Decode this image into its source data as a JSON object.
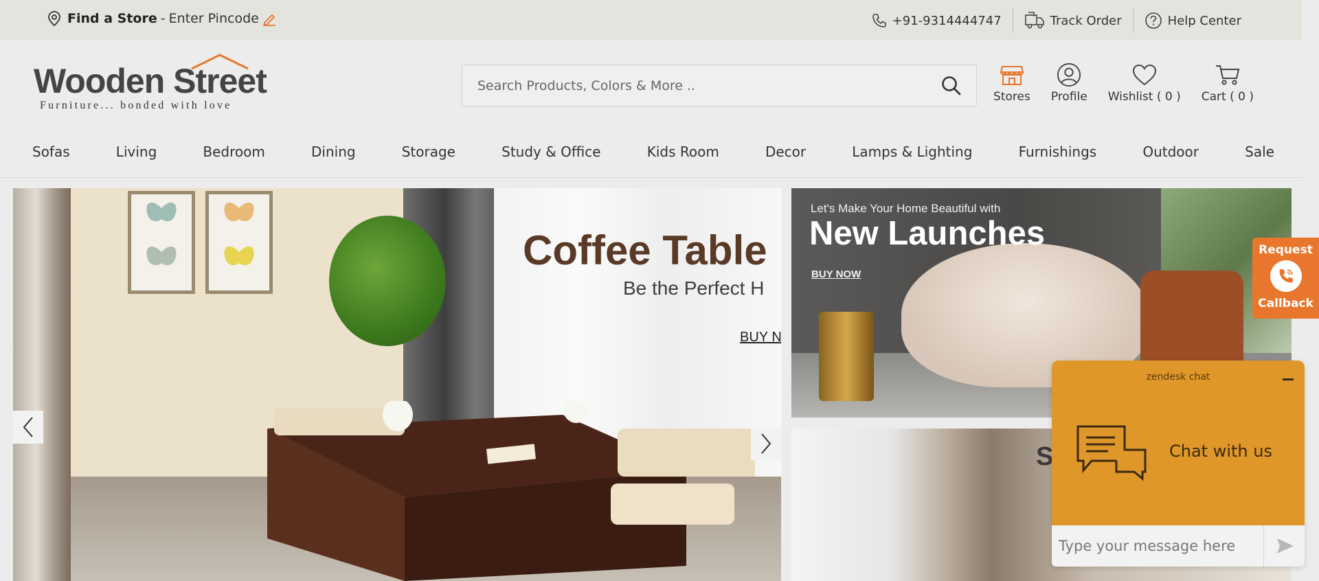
{
  "topbar": {
    "find_store": "Find a Store",
    "dash": "-",
    "pincode": "Enter Pincode",
    "phone": "+91-9314444747",
    "track_order": "Track Order",
    "help_center": "Help Center"
  },
  "header": {
    "logo_name": "Wooden Street",
    "logo_tagline": "Furniture... bonded with love",
    "search_placeholder": "Search Products, Colors & More ..",
    "stores": "Stores",
    "profile": "Profile",
    "wishlist": "Wishlist ( 0 )",
    "cart": "Cart ( 0 )"
  },
  "nav": {
    "items": [
      "Sofas",
      "Living",
      "Bedroom",
      "Dining",
      "Storage",
      "Study & Office",
      "Kids Room",
      "Decor",
      "Lamps & Lighting",
      "Furnishings",
      "Outdoor",
      "Sale"
    ]
  },
  "hero": {
    "title": "Coffee Table",
    "subtitle": "Be the Perfect H",
    "cta": "BUY N"
  },
  "side_banner_1": {
    "kicker": "Let's Make Your Home Beautiful with",
    "title": "New Launches",
    "cta": "BUY NOW"
  },
  "side_banner_2": {
    "title_fragment": "S"
  },
  "callback": {
    "line1": "Request",
    "line2": "Callback"
  },
  "chat": {
    "brand": "zendesk chat",
    "cta": "Chat with us",
    "input_placeholder": "Type your message here"
  },
  "colors": {
    "accent_orange": "#e8762c",
    "chat_orange": "#e0972a",
    "topbar_bg": "#e4e4df",
    "text_dark": "#333333"
  }
}
